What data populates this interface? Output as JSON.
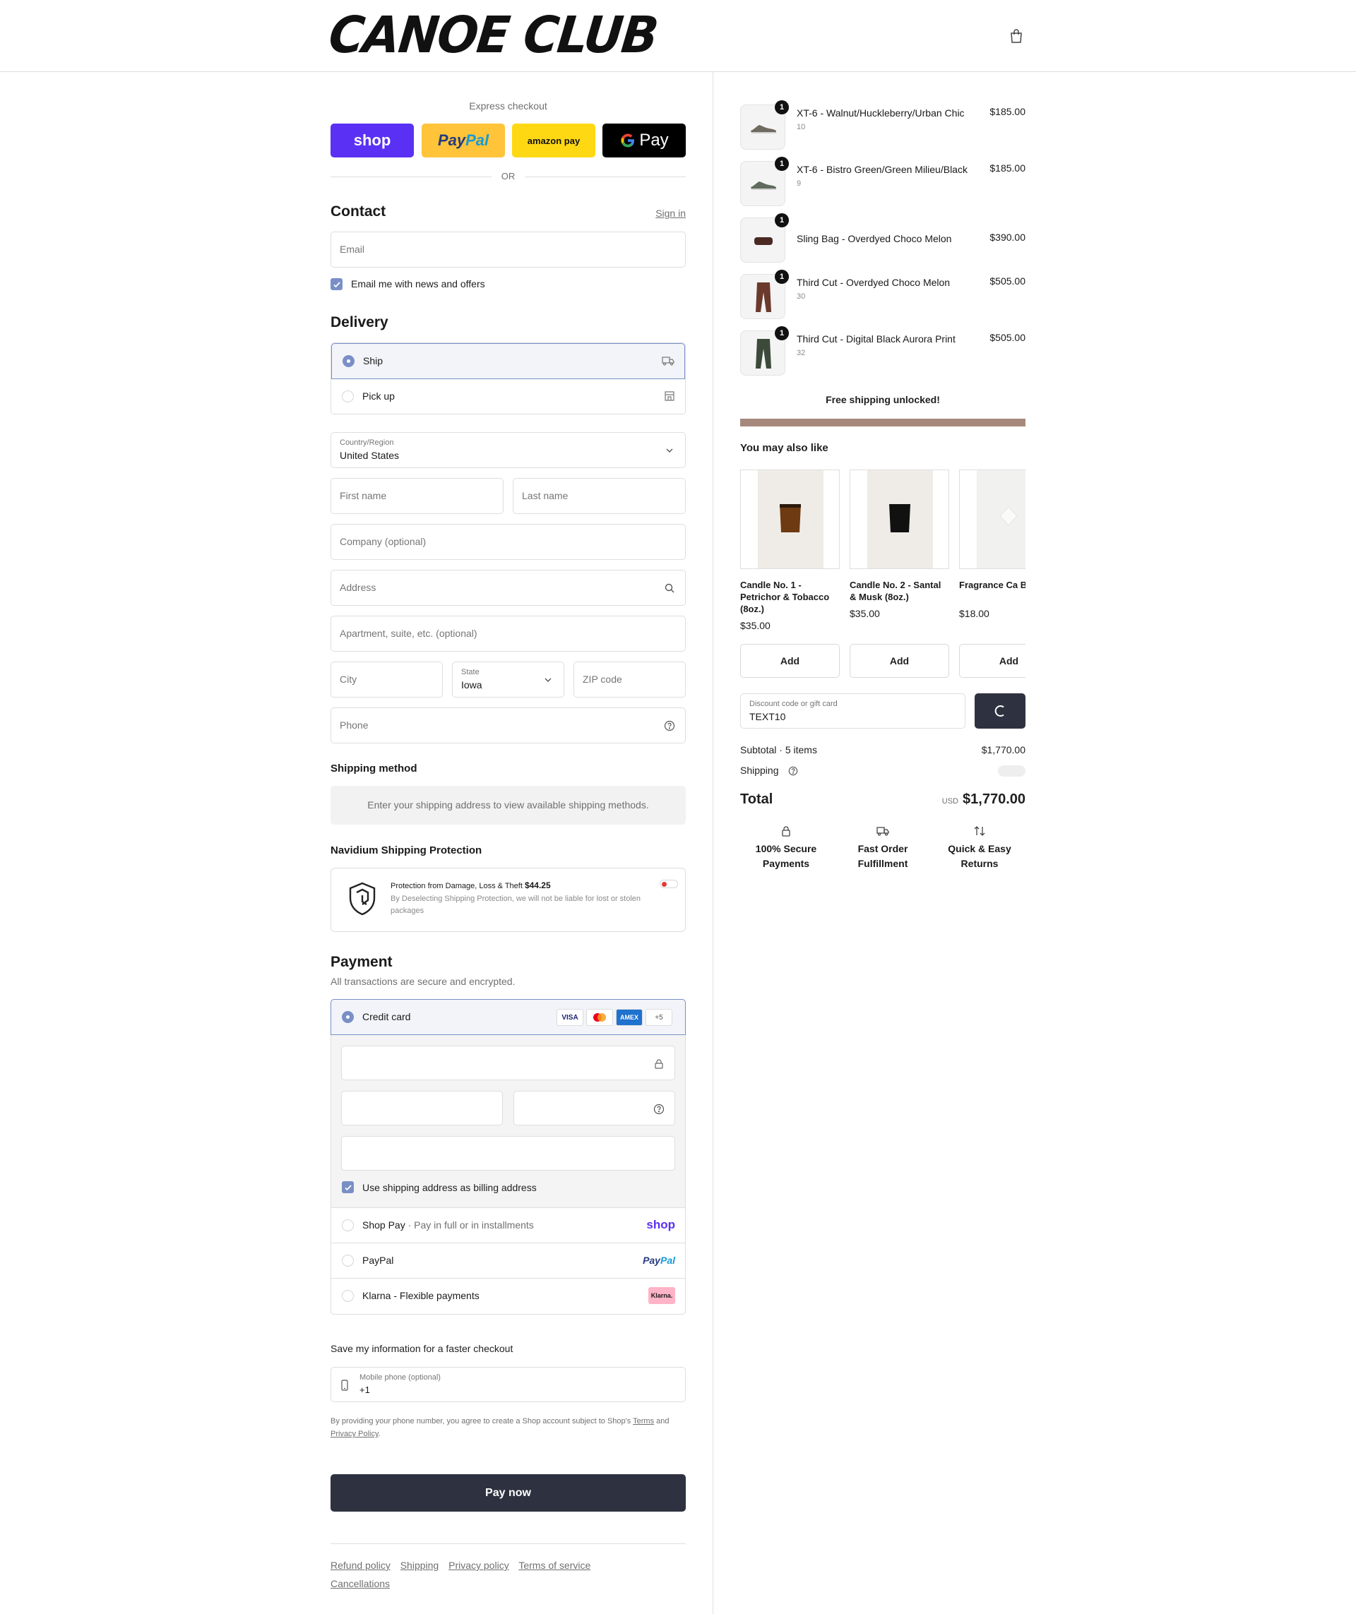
{
  "brand": {
    "logo": "CANOE CLUB"
  },
  "express": {
    "label": "Express checkout",
    "shop": "shop",
    "paypal_a": "Pay",
    "paypal_b": "Pal",
    "amazon": "amazon pay",
    "gpay": "Pay",
    "or": "OR"
  },
  "contact": {
    "title": "Contact",
    "sign_in": "Sign in",
    "email_placeholder": "Email",
    "newsletter": "Email me with news and offers"
  },
  "delivery": {
    "title": "Delivery",
    "ship": "Ship",
    "pickup": "Pick up",
    "country_label": "Country/Region",
    "country_value": "United States",
    "first_name": "First name",
    "last_name": "Last name",
    "company": "Company (optional)",
    "address": "Address",
    "apartment": "Apartment, suite, etc. (optional)",
    "city": "City",
    "state_label": "State",
    "state_value": "Iowa",
    "zip": "ZIP code",
    "phone": "Phone"
  },
  "shipping_method": {
    "title": "Shipping method",
    "info": "Enter your shipping address to view available shipping methods."
  },
  "protection": {
    "title": "Navidium Shipping Protection",
    "headline": "Protection from Damage, Loss & Theft",
    "price": "$44.25",
    "note": "By Deselecting Shipping Protection, we will not be liable for lost or stolen packages",
    "enabled": true
  },
  "payment": {
    "title": "Payment",
    "subtitle": "All transactions are secure and encrypted.",
    "credit_card": "Credit card",
    "cards": [
      "VISA",
      "MC",
      "AMEX",
      "+5"
    ],
    "billing_same": "Use shipping address as billing address",
    "shop_pay": "Shop Pay",
    "shop_pay_note": "· Pay in full or in installments",
    "shop_pay_logo": "shop",
    "paypal": "PayPal",
    "paypal_logo_a": "Pay",
    "paypal_logo_b": "Pal",
    "klarna": "Klarna - Flexible payments",
    "klarna_logo": "Klarna."
  },
  "save_info": {
    "title": "Save my information for a faster checkout",
    "mobile_label": "Mobile phone (optional)",
    "mobile_value": "+1",
    "legal_1": "By providing your phone number, you agree to create a Shop account subject to Shop's",
    "terms": "Terms",
    "and": "and",
    "privacy": "Privacy Policy",
    "period": "."
  },
  "pay_now": "Pay now",
  "footer": [
    "Refund policy",
    "Shipping",
    "Privacy policy",
    "Terms of service",
    "Cancellations"
  ],
  "cart": {
    "items": [
      {
        "name": "XT-6 - Walnut/Huckleberry/Urban Chic",
        "variant": "10",
        "price": "$185.00",
        "qty": "1"
      },
      {
        "name": "XT-6 - Bistro Green/Green Milieu/Black",
        "variant": "9",
        "price": "$185.00",
        "qty": "1"
      },
      {
        "name": "Sling Bag - Overdyed Choco Melon",
        "variant": "",
        "price": "$390.00",
        "qty": "1"
      },
      {
        "name": "Third Cut - Overdyed Choco Melon",
        "variant": "30",
        "price": "$505.00",
        "qty": "1"
      },
      {
        "name": "Third Cut - Digital Black Aurora Print",
        "variant": "32",
        "price": "$505.00",
        "qty": "1"
      }
    ],
    "free_shipping": "Free shipping unlocked!",
    "free_shipping_progress": 1.0,
    "recommend_title": "You may also like",
    "recommendations": [
      {
        "name": "Candle No. 1 - Petrichor & Tobacco (8oz.)",
        "price": "$35.00",
        "add": "Add"
      },
      {
        "name": "Candle No. 2 - Santal & Musk (8oz.)",
        "price": "$35.00",
        "add": "Add"
      },
      {
        "name": "Fragrance Ca Barney",
        "price": "$18.00",
        "add": "Add"
      }
    ],
    "discount_label": "Discount code or gift card",
    "discount_value": "TEXT10",
    "subtotal_label": "Subtotal · 5 items",
    "subtotal_value": "$1,770.00",
    "shipping_label": "Shipping",
    "total_label": "Total",
    "currency": "USD",
    "total_value": "$1,770.00",
    "features": [
      {
        "line1": "100% Secure",
        "line2": "Payments",
        "icon": "lock-icon"
      },
      {
        "line1": "Fast Order",
        "line2": "Fulfillment",
        "icon": "truck-icon"
      },
      {
        "line1": "Quick & Easy",
        "line2": "Returns",
        "icon": "return-arrows-icon"
      }
    ]
  },
  "colors": {
    "accent": "#7a8fc6",
    "pay_button": "#2e3240",
    "shop_purple": "#5a31f4",
    "paypal_yellow": "#ffc439",
    "amazon_yellow": "#ffd814",
    "progress_brown": "#a6897c"
  }
}
